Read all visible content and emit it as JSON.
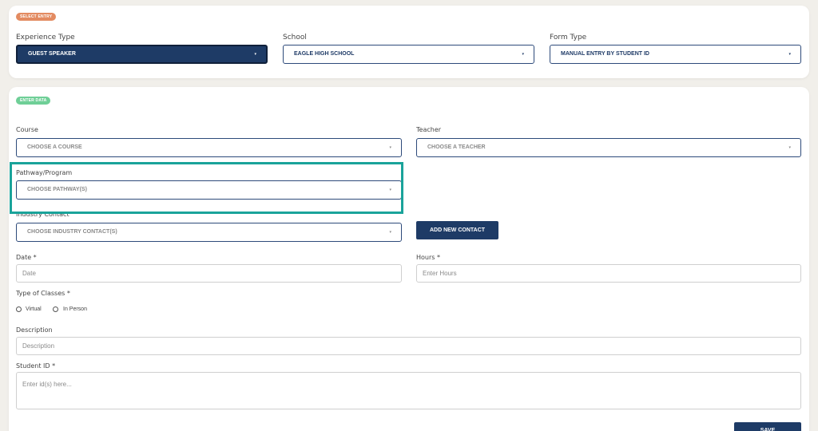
{
  "select_entry": {
    "badge": "SELECT ENTRY",
    "experience_type": {
      "label": "Experience Type",
      "value": "GUEST SPEAKER"
    },
    "school": {
      "label": "School",
      "value": "EAGLE HIGH SCHOOL"
    },
    "form_type": {
      "label": "Form Type",
      "value": "MANUAL ENTRY BY STUDENT ID"
    }
  },
  "enter_data": {
    "badge": "ENTER DATA",
    "course": {
      "label": "Course",
      "value": "CHOOSE A COURSE"
    },
    "teacher": {
      "label": "Teacher",
      "value": "CHOOSE A TEACHER"
    },
    "pathway": {
      "label": "Pathway/Program",
      "value": "CHOOSE PATHWAY(S)"
    },
    "industry_contact": {
      "label": "Industry Contact",
      "value": "CHOOSE INDUSTRY CONTACT(S)"
    },
    "add_contact_label": "ADD NEW CONTACT",
    "date": {
      "label": "Date *",
      "placeholder": "Date"
    },
    "hours": {
      "label": "Hours *",
      "placeholder": "Enter Hours"
    },
    "type_of_classes": {
      "label": "Type of Classes *",
      "options": [
        "Virtual",
        "In Person"
      ]
    },
    "description": {
      "label": "Description",
      "placeholder": "Description"
    },
    "student_id": {
      "label": "Student ID *",
      "placeholder": "Enter id(s) here..."
    },
    "save_label": "SAVE"
  },
  "caret": "▾",
  "colors": {
    "primary": "#1e3b66",
    "highlight": "#1aa39a",
    "badge_select": "#e38b61",
    "badge_enter": "#6fcf97"
  }
}
